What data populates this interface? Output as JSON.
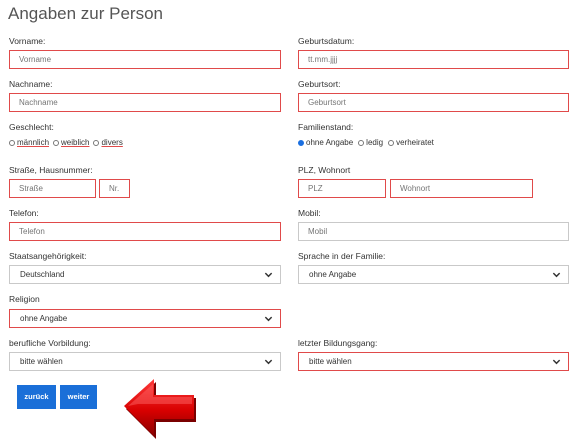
{
  "page_title": "Angaben zur Person",
  "left": {
    "vorname": {
      "label": "Vorname:",
      "placeholder": "Vorname"
    },
    "nachname": {
      "label": "Nachname:",
      "placeholder": "Nachname"
    },
    "geschlecht": {
      "label": "Geschlecht:",
      "options": [
        "männlich",
        "weiblich",
        "divers"
      ]
    },
    "strasse": {
      "label": "Straße, Hausnummer:",
      "placeholder_street": "Straße",
      "placeholder_nr": "Nr."
    },
    "telefon": {
      "label": "Telefon:",
      "placeholder": "Telefon"
    },
    "staat": {
      "label": "Staatsangehörigkeit:",
      "value": "Deutschland"
    },
    "religion": {
      "label": "Religion",
      "value": "ohne Angabe"
    },
    "vorbildung": {
      "label": "berufliche Vorbildung:",
      "value": "bitte wählen"
    }
  },
  "right": {
    "geburtsdatum": {
      "label": "Geburtsdatum:",
      "placeholder": "tt.mm.jjjj"
    },
    "geburtsort": {
      "label": "Geburtsort:",
      "placeholder": "Geburtsort"
    },
    "familienstand": {
      "label": "Familienstand:",
      "options": [
        "ohne Angabe",
        "ledig",
        "verheiratet"
      ],
      "selected": "ohne Angabe"
    },
    "plz": {
      "label": "PLZ, Wohnort",
      "placeholder_plz": "PLZ",
      "placeholder_ort": "Wohnort"
    },
    "mobil": {
      "label": "Mobil:",
      "placeholder": "Mobil"
    },
    "sprache": {
      "label": "Sprache in der Familie:",
      "value": "ohne Angabe"
    },
    "bildungsgang": {
      "label": "letzter Bildungsgang:",
      "value": "bitte wählen"
    }
  },
  "buttons": {
    "back": "zurück",
    "next": "weiter"
  },
  "colors": {
    "accent_blue": "#1a6fd8",
    "error_red": "#e04a4a",
    "arrow_red": "#d40000"
  },
  "icons": {
    "select_arrow": "chevron-down-icon",
    "pointer": "red-arrow-left-icon"
  }
}
